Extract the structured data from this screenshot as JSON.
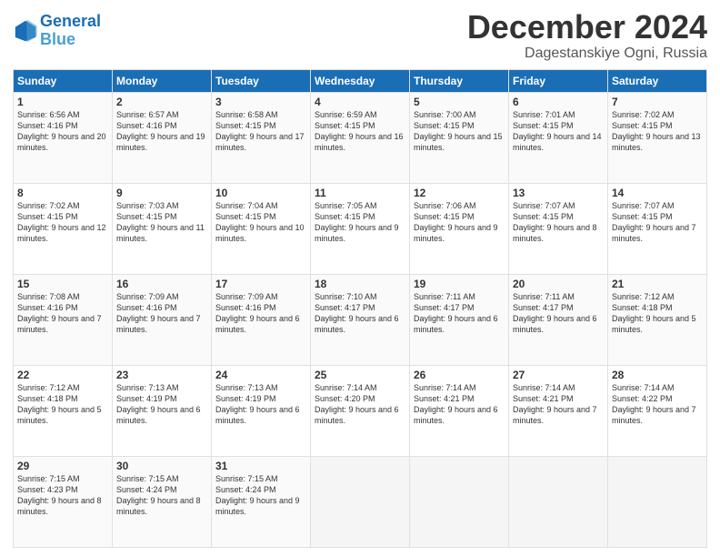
{
  "logo": {
    "line1": "General",
    "line2": "Blue"
  },
  "title": "December 2024",
  "location": "Dagestanskiye Ogni, Russia",
  "headers": [
    "Sunday",
    "Monday",
    "Tuesday",
    "Wednesday",
    "Thursday",
    "Friday",
    "Saturday"
  ],
  "weeks": [
    [
      {
        "day": "1",
        "sunrise": "6:56 AM",
        "sunset": "4:16 PM",
        "daylight": "9 hours and 20 minutes."
      },
      {
        "day": "2",
        "sunrise": "6:57 AM",
        "sunset": "4:16 PM",
        "daylight": "9 hours and 19 minutes."
      },
      {
        "day": "3",
        "sunrise": "6:58 AM",
        "sunset": "4:15 PM",
        "daylight": "9 hours and 17 minutes."
      },
      {
        "day": "4",
        "sunrise": "6:59 AM",
        "sunset": "4:15 PM",
        "daylight": "9 hours and 16 minutes."
      },
      {
        "day": "5",
        "sunrise": "7:00 AM",
        "sunset": "4:15 PM",
        "daylight": "9 hours and 15 minutes."
      },
      {
        "day": "6",
        "sunrise": "7:01 AM",
        "sunset": "4:15 PM",
        "daylight": "9 hours and 14 minutes."
      },
      {
        "day": "7",
        "sunrise": "7:02 AM",
        "sunset": "4:15 PM",
        "daylight": "9 hours and 13 minutes."
      }
    ],
    [
      {
        "day": "8",
        "sunrise": "7:02 AM",
        "sunset": "4:15 PM",
        "daylight": "9 hours and 12 minutes."
      },
      {
        "day": "9",
        "sunrise": "7:03 AM",
        "sunset": "4:15 PM",
        "daylight": "9 hours and 11 minutes."
      },
      {
        "day": "10",
        "sunrise": "7:04 AM",
        "sunset": "4:15 PM",
        "daylight": "9 hours and 10 minutes."
      },
      {
        "day": "11",
        "sunrise": "7:05 AM",
        "sunset": "4:15 PM",
        "daylight": "9 hours and 9 minutes."
      },
      {
        "day": "12",
        "sunrise": "7:06 AM",
        "sunset": "4:15 PM",
        "daylight": "9 hours and 9 minutes."
      },
      {
        "day": "13",
        "sunrise": "7:07 AM",
        "sunset": "4:15 PM",
        "daylight": "9 hours and 8 minutes."
      },
      {
        "day": "14",
        "sunrise": "7:07 AM",
        "sunset": "4:15 PM",
        "daylight": "9 hours and 7 minutes."
      }
    ],
    [
      {
        "day": "15",
        "sunrise": "7:08 AM",
        "sunset": "4:16 PM",
        "daylight": "9 hours and 7 minutes."
      },
      {
        "day": "16",
        "sunrise": "7:09 AM",
        "sunset": "4:16 PM",
        "daylight": "9 hours and 7 minutes."
      },
      {
        "day": "17",
        "sunrise": "7:09 AM",
        "sunset": "4:16 PM",
        "daylight": "9 hours and 6 minutes."
      },
      {
        "day": "18",
        "sunrise": "7:10 AM",
        "sunset": "4:17 PM",
        "daylight": "9 hours and 6 minutes."
      },
      {
        "day": "19",
        "sunrise": "7:11 AM",
        "sunset": "4:17 PM",
        "daylight": "9 hours and 6 minutes."
      },
      {
        "day": "20",
        "sunrise": "7:11 AM",
        "sunset": "4:17 PM",
        "daylight": "9 hours and 6 minutes."
      },
      {
        "day": "21",
        "sunrise": "7:12 AM",
        "sunset": "4:18 PM",
        "daylight": "9 hours and 5 minutes."
      }
    ],
    [
      {
        "day": "22",
        "sunrise": "7:12 AM",
        "sunset": "4:18 PM",
        "daylight": "9 hours and 5 minutes."
      },
      {
        "day": "23",
        "sunrise": "7:13 AM",
        "sunset": "4:19 PM",
        "daylight": "9 hours and 6 minutes."
      },
      {
        "day": "24",
        "sunrise": "7:13 AM",
        "sunset": "4:19 PM",
        "daylight": "9 hours and 6 minutes."
      },
      {
        "day": "25",
        "sunrise": "7:14 AM",
        "sunset": "4:20 PM",
        "daylight": "9 hours and 6 minutes."
      },
      {
        "day": "26",
        "sunrise": "7:14 AM",
        "sunset": "4:21 PM",
        "daylight": "9 hours and 6 minutes."
      },
      {
        "day": "27",
        "sunrise": "7:14 AM",
        "sunset": "4:21 PM",
        "daylight": "9 hours and 7 minutes."
      },
      {
        "day": "28",
        "sunrise": "7:14 AM",
        "sunset": "4:22 PM",
        "daylight": "9 hours and 7 minutes."
      }
    ],
    [
      {
        "day": "29",
        "sunrise": "7:15 AM",
        "sunset": "4:23 PM",
        "daylight": "9 hours and 8 minutes."
      },
      {
        "day": "30",
        "sunrise": "7:15 AM",
        "sunset": "4:24 PM",
        "daylight": "9 hours and 8 minutes."
      },
      {
        "day": "31",
        "sunrise": "7:15 AM",
        "sunset": "4:24 PM",
        "daylight": "9 hours and 9 minutes."
      },
      null,
      null,
      null,
      null
    ]
  ]
}
